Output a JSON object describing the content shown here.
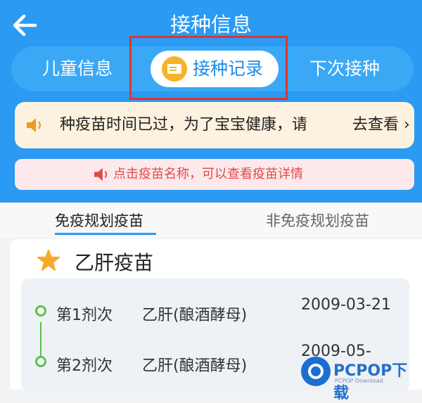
{
  "header": {
    "title": "接种信息",
    "tabs": {
      "child_info": "儿童信息",
      "records": "接种记录",
      "next": "下次接种"
    }
  },
  "notice": {
    "text": "种疫苗时间已过，为了宝宝健康，请",
    "action": "去查看",
    "chevron": "›"
  },
  "hint": {
    "text": "点击疫苗名称，可以查看疫苗详情"
  },
  "subtabs": {
    "planned": "免疫规划疫苗",
    "unplanned": "非免疫规划疫苗"
  },
  "vaccine": {
    "name": "乙肝疫苗",
    "doses": [
      {
        "dose": "第1剂次",
        "type": "乙肝(酿酒酵母)",
        "date": "2009-03-21"
      },
      {
        "dose": "第2剂次",
        "type": "乙肝(酿酒酵母)",
        "date": "2009-05-"
      }
    ]
  },
  "watermark": {
    "brand": "PCPOP下载",
    "sub": "PCPOP Download"
  },
  "colors": {
    "header": "#2a9af2",
    "highlight": "#e0332f",
    "timeline": "#57c24b"
  }
}
